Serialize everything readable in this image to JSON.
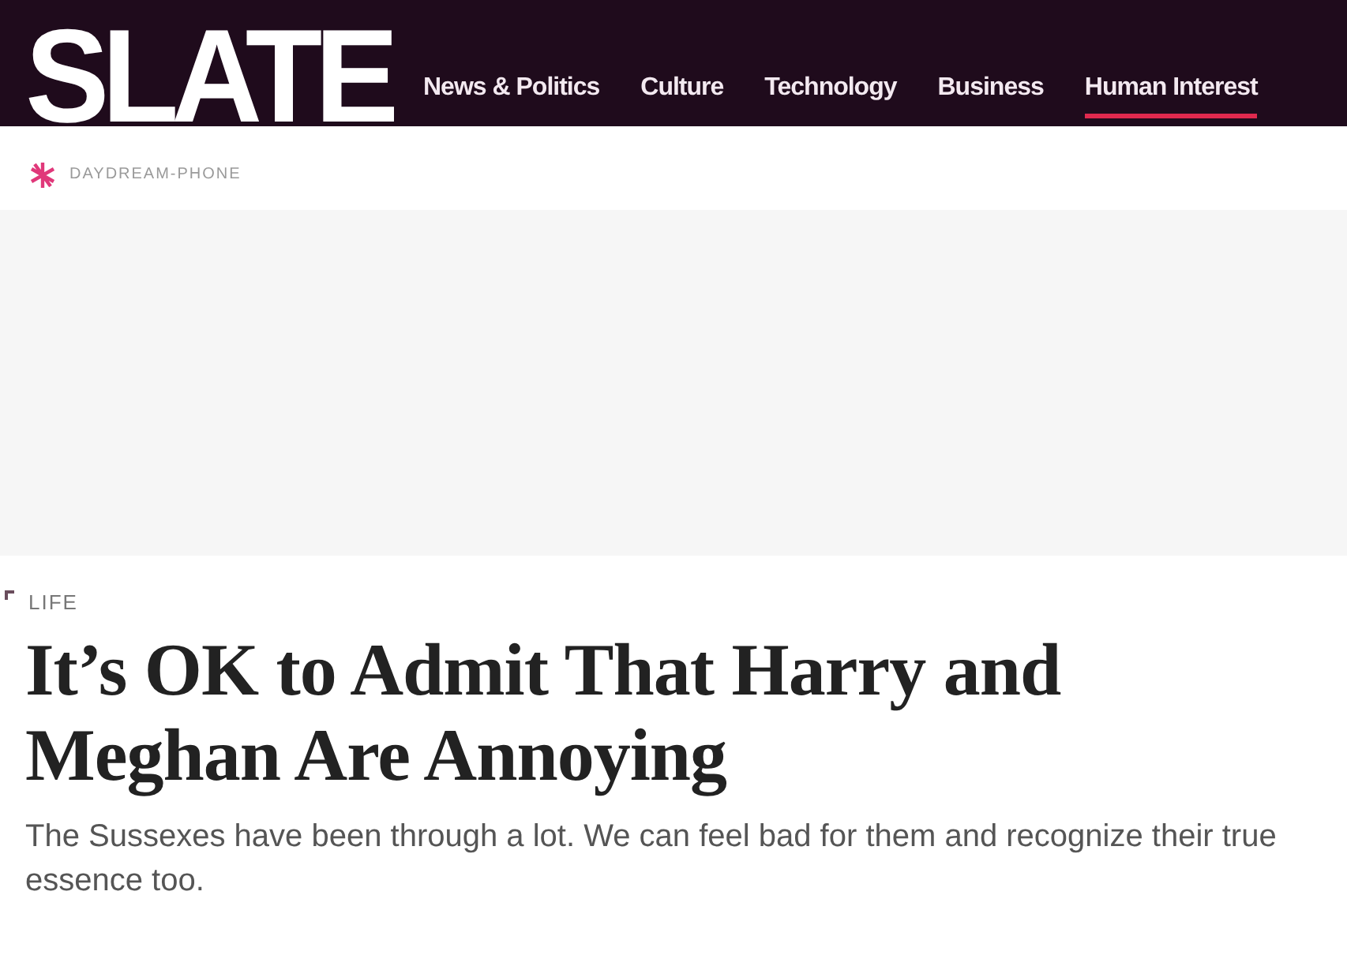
{
  "logo": "SLATE",
  "nav": [
    {
      "label": "News & Politics",
      "selected": false
    },
    {
      "label": "Culture",
      "selected": false
    },
    {
      "label": "Technology",
      "selected": false
    },
    {
      "label": "Business",
      "selected": false
    },
    {
      "label": "Human Interest",
      "selected": true
    }
  ],
  "podcast_label": "DAYDREAM-PHONE",
  "article": {
    "section": "LIFE",
    "headline": "It’s OK to Admit That Harry and Meghan Are Annoying",
    "deck": "The Sussexes have been through a lot. We can feel bad for them and recognize their true essence too."
  }
}
